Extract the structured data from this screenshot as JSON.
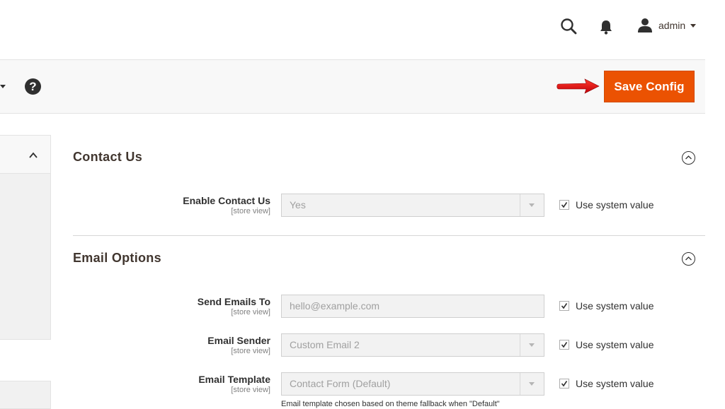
{
  "header": {
    "user_name": "admin",
    "icons": {
      "search": "search-icon",
      "notifications": "bell-icon",
      "user": "user-icon"
    }
  },
  "actions": {
    "help_symbol": "?",
    "save_label": "Save Config",
    "colors": {
      "accent": "#eb5202",
      "annotation_arrow": "#e0000b"
    }
  },
  "sections": [
    {
      "title": "Contact Us",
      "fields": [
        {
          "label": "Enable Contact Us",
          "scope": "[store view]",
          "value": "Yes",
          "type": "select",
          "use_system": "Use system value",
          "checked": true
        }
      ]
    },
    {
      "title": "Email Options",
      "fields": [
        {
          "label": "Send Emails To",
          "scope": "[store view]",
          "placeholder": "hello@example.com",
          "type": "text",
          "use_system": "Use system value",
          "checked": true
        },
        {
          "label": "Email Sender",
          "scope": "[store view]",
          "value": "Custom Email 2",
          "type": "select",
          "use_system": "Use system value",
          "checked": true
        },
        {
          "label": "Email Template",
          "scope": "[store view]",
          "value": "Contact Form (Default)",
          "type": "select",
          "use_system": "Use system value",
          "checked": true,
          "note": "Email template chosen based on theme fallback when \"Default\""
        }
      ]
    }
  ]
}
